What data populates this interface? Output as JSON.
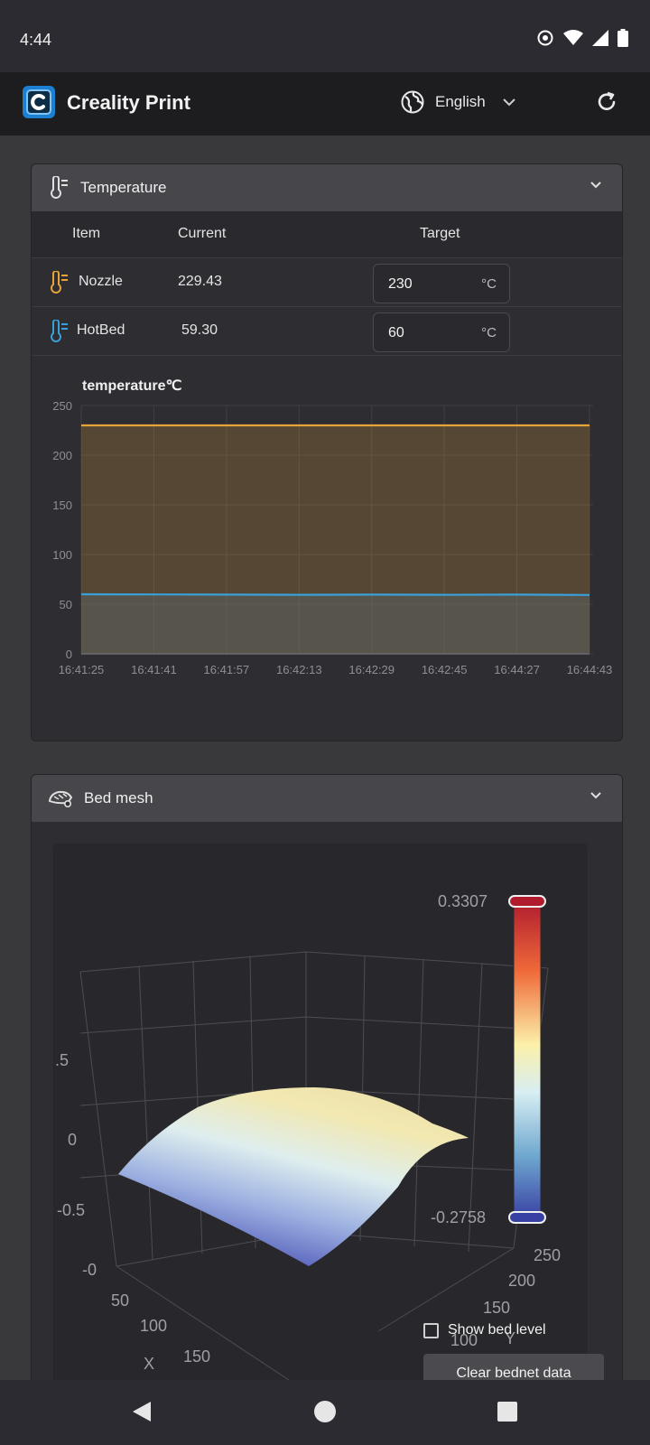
{
  "status": {
    "time": "4:44"
  },
  "app": {
    "title": "Creality Print",
    "language": "English",
    "logo_letter": "C"
  },
  "temperature_card": {
    "title": "Temperature",
    "headers": {
      "item": "Item",
      "current": "Current",
      "target": "Target"
    },
    "rows": [
      {
        "name": "Nozzle",
        "current": "229.43",
        "target": "230",
        "unit": "°C",
        "color": "#e8a33a"
      },
      {
        "name": "HotBed",
        "current": "59.30",
        "target": "60",
        "unit": "°C",
        "color": "#3aa0d8"
      }
    ]
  },
  "chart_data": {
    "type": "area",
    "title": "temperature℃",
    "x": [
      "16:41:25",
      "16:41:41",
      "16:41:57",
      "16:42:13",
      "16:42:29",
      "16:42:45",
      "16:44:27",
      "16:44:43"
    ],
    "yticks": [
      0,
      50,
      100,
      150,
      200,
      250
    ],
    "ylim": [
      0,
      250
    ],
    "grid": true,
    "series": [
      {
        "values": [
          230,
          230,
          230,
          230,
          230,
          230,
          230,
          230
        ],
        "color": "#e8a33a"
      },
      {
        "values": [
          60,
          59.8,
          59.6,
          59.5,
          59.6,
          59.5,
          59.6,
          59.3
        ],
        "color": "#3aa0d8"
      }
    ]
  },
  "bed_mesh_card": {
    "title": "Bed mesh",
    "color_max": "0.3307",
    "color_min": "-0.2758",
    "z_ticks": [
      ".5",
      "0",
      "-0.5",
      "-0"
    ],
    "x_ticks": [
      "50",
      "100",
      "150"
    ],
    "x_label": "X",
    "y_ticks": [
      "250",
      "200",
      "150",
      "100"
    ],
    "y_label": "Y",
    "show_bed_level": "Show bed level",
    "clear_button": "Clear bednet data"
  }
}
